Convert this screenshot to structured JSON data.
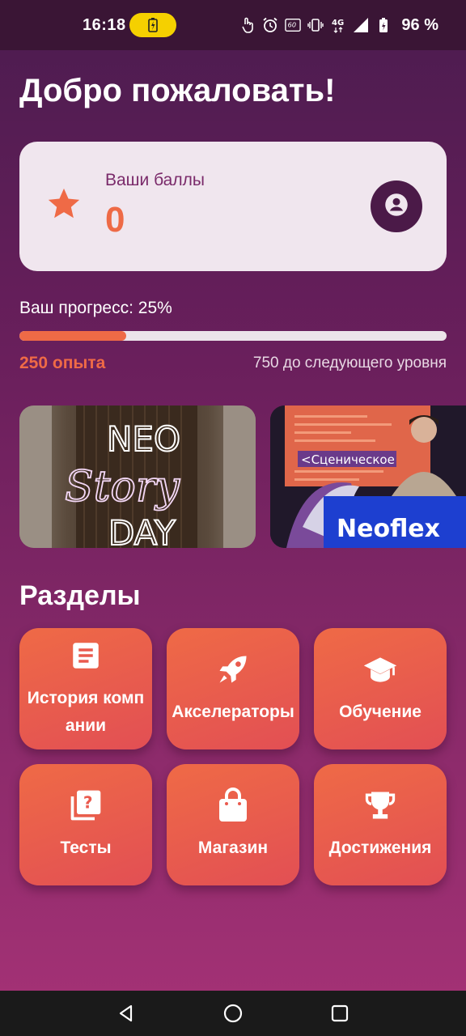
{
  "status_bar": {
    "time": "16:18",
    "battery_percent": "96 %",
    "icons": [
      "charging-pill-icon",
      "touch-icon",
      "alarm-icon",
      "hz-60-icon",
      "vibrate-icon",
      "4g-icon",
      "signal-icon",
      "battery-icon"
    ]
  },
  "header": {
    "title": "Добро пожаловать!"
  },
  "points": {
    "label": "Ваши баллы",
    "value": "0",
    "icon": "star-icon",
    "profile_icon": "account-icon"
  },
  "progress": {
    "label": "Ваш прогресс: 25%",
    "value": 0.25,
    "current_xp": "250 опыта",
    "next_level": "750 до следующего уровня"
  },
  "banners": [
    {
      "title": "NEO Story DAY"
    },
    {
      "title": "Neoflex",
      "caption": "<Сценическое"
    }
  ],
  "sections": {
    "title": "Разделы",
    "items": [
      {
        "label": "История компании",
        "icon": "document-icon"
      },
      {
        "label": "Акселераторы",
        "icon": "rocket-icon"
      },
      {
        "label": "Обучение",
        "icon": "graduation-cap-icon"
      },
      {
        "label": "Тесты",
        "icon": "quiz-icon"
      },
      {
        "label": "Магазин",
        "icon": "shopping-bag-icon"
      },
      {
        "label": "Достижения",
        "icon": "trophy-icon"
      }
    ]
  },
  "colors": {
    "accent": "#ef6a46",
    "card_bg": "#f0e6ee",
    "bg_top": "#4b1c4f",
    "bg_bottom": "#a63276"
  }
}
